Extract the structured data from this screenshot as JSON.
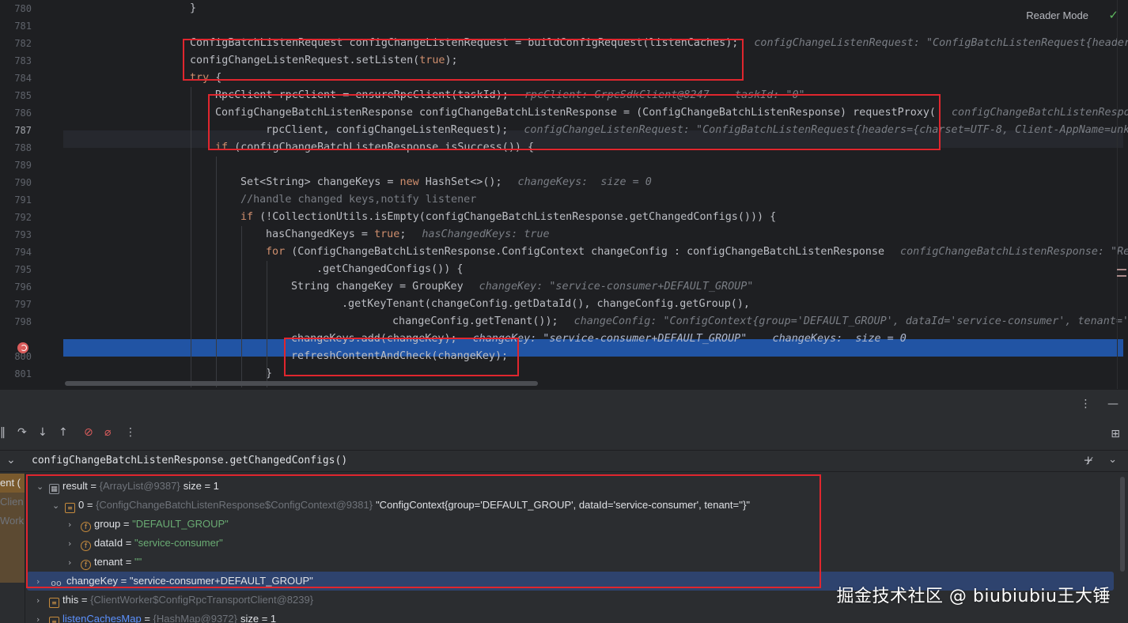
{
  "editor": {
    "reader_mode_label": "Reader Mode",
    "lines": [
      {
        "num": "780",
        "indent": 5,
        "text": "}"
      },
      {
        "num": "781",
        "indent": 0,
        "text": ""
      },
      {
        "num": "782",
        "indent": 5,
        "text": "ConfigBatchListenRequest configChangeListenRequest = buildConfigRequest(listenCaches);",
        "hint": "configChangeListenRequest: \"ConfigBatchListenRequest{header"
      },
      {
        "num": "783",
        "indent": 5,
        "text": "configChangeListenRequest.setListen(true);"
      },
      {
        "num": "784",
        "indent": 5,
        "text": "try {"
      },
      {
        "num": "785",
        "indent": 6,
        "text": "RpcClient rpcClient = ensureRpcClient(taskId);",
        "hint": "rpcClient: GrpcSdkClient@8247    taskId: \"0\""
      },
      {
        "num": "786",
        "indent": 6,
        "text": "ConfigChangeBatchListenResponse configChangeBatchListenResponse = (ConfigChangeBatchListenResponse) requestProxy(",
        "hint": "configChangeBatchListenRespo"
      },
      {
        "num": "787",
        "indent": 8,
        "text": "rpcClient, configChangeListenRequest);",
        "hint": "configChangeListenRequest: \"ConfigBatchListenRequest{headers={charset=UTF-8, Client-AppName=unk"
      },
      {
        "num": "788",
        "indent": 6,
        "text": "if (configChangeBatchListenResponse.isSuccess()) {"
      },
      {
        "num": "789",
        "indent": 0,
        "text": ""
      },
      {
        "num": "790",
        "indent": 7,
        "text": "Set<String> changeKeys = new HashSet<>();",
        "hint": "changeKeys:  size = 0"
      },
      {
        "num": "791",
        "indent": 7,
        "text": "//handle changed keys,notify listener"
      },
      {
        "num": "792",
        "indent": 7,
        "text": "if (!CollectionUtils.isEmpty(configChangeBatchListenResponse.getChangedConfigs())) {"
      },
      {
        "num": "793",
        "indent": 8,
        "text": "hasChangedKeys = true;",
        "hint": "hasChangedKeys: true"
      },
      {
        "num": "794",
        "indent": 8,
        "text": "for (ConfigChangeBatchListenResponse.ConfigContext changeConfig : configChangeBatchListenResponse",
        "hint": "configChangeBatchListenResponse: \"Re"
      },
      {
        "num": "795",
        "indent": 10,
        "text": ".getChangedConfigs()) {"
      },
      {
        "num": "796",
        "indent": 9,
        "text": "String changeKey = GroupKey",
        "hint": "changeKey: \"service-consumer+DEFAULT_GROUP\""
      },
      {
        "num": "797",
        "indent": 11,
        "text": ".getKeyTenant(changeConfig.getDataId(), changeConfig.getGroup(),"
      },
      {
        "num": "798",
        "indent": 13,
        "text": "changeConfig.getTenant());",
        "hint": "changeConfig: \"ConfigContext{group='DEFAULT_GROUP', dataId='service-consumer', tenant='"
      },
      {
        "num": "",
        "indent": 9,
        "text": "changeKeys.add(changeKey);",
        "hint": "changeKey: \"service-consumer+DEFAULT_GROUP\"    changeKeys:  size = 0"
      },
      {
        "num": "800",
        "indent": 9,
        "text": "refreshContentAndCheck(changeKey);"
      },
      {
        "num": "801",
        "indent": 8,
        "text": "}"
      }
    ]
  },
  "debugger": {
    "expression": "configChangeBatchListenResponse.getChangedConfigs()",
    "frames": [
      "ent (",
      "Clien",
      "Work"
    ],
    "variables": [
      {
        "level": 0,
        "arrow": "⌄",
        "badge": "sq",
        "badge_glyph": "▦",
        "name": "result",
        "ref": "{ArrayList@9387}",
        "value": "size = 1",
        "value_kind": "plain"
      },
      {
        "level": 1,
        "arrow": "⌄",
        "badge": "stack",
        "badge_glyph": "≡",
        "name": "0",
        "ref": "{ConfigChangeBatchListenResponse$ConfigContext@9381}",
        "value": "\"ConfigContext{group='DEFAULT_GROUP', dataId='service-consumer', tenant=''}\"",
        "value_kind": "plain"
      },
      {
        "level": 2,
        "arrow": "›",
        "badge": "field",
        "badge_glyph": "f",
        "name": "group",
        "ref": "",
        "value": "\"DEFAULT_GROUP\"",
        "value_kind": "str"
      },
      {
        "level": 2,
        "arrow": "›",
        "badge": "field",
        "badge_glyph": "f",
        "name": "dataId",
        "ref": "",
        "value": "\"service-consumer\"",
        "value_kind": "str"
      },
      {
        "level": 2,
        "arrow": "›",
        "badge": "field",
        "badge_glyph": "f",
        "name": "tenant",
        "ref": "",
        "value": "\"\"",
        "value_kind": "str"
      },
      {
        "level": 0,
        "arrow": "›",
        "badge": "glasses",
        "badge_glyph": "oo",
        "name": "changeKey",
        "ref": "",
        "value": "\"service-consumer+DEFAULT_GROUP\"",
        "value_kind": "plain",
        "selected": true
      },
      {
        "level": 0,
        "arrow": "›",
        "badge": "stack",
        "badge_glyph": "≡",
        "name": "this",
        "ref": "{ClientWorker$ConfigRpcTransportClient@8239}",
        "value": "",
        "value_kind": "plain"
      },
      {
        "level": 0,
        "arrow": "›",
        "badge": "stack",
        "badge_glyph": "≡",
        "name": "listenCachesMap",
        "ref": "{HashMap@9372}",
        "value": "size = 1",
        "value_kind": "plain",
        "link": true
      }
    ]
  },
  "watermark": "掘金技术社区 @ biubiubiu王大锤",
  "colors": {
    "accent_highlight": "#2154a4",
    "annotation_red": "#e0262e",
    "string_green": "#6aab73",
    "keyword_orange": "#cf8e6d"
  }
}
